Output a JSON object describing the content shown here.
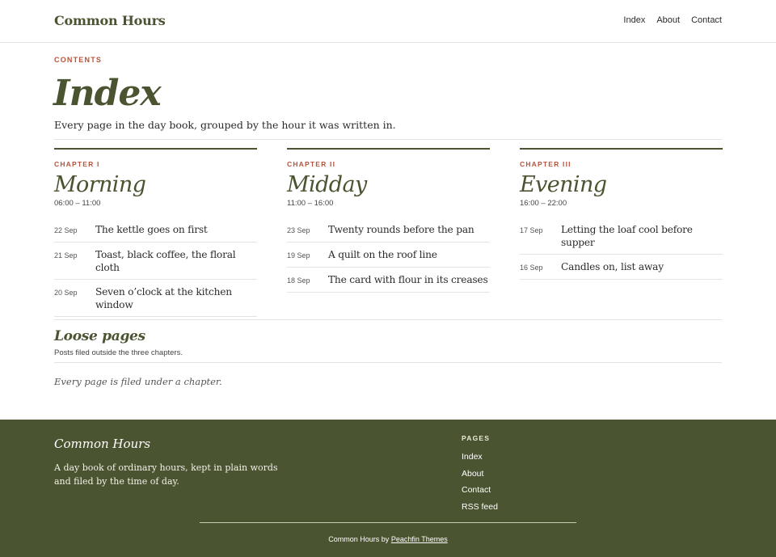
{
  "site": {
    "brand": "Common Hours"
  },
  "nav": {
    "items": [
      "Index",
      "About",
      "Contact"
    ]
  },
  "page": {
    "eyebrow": "CONTENTS",
    "title": "Index",
    "lede": "Every page in the day book, grouped by the hour it was written in."
  },
  "chapters": [
    {
      "label": "CHAPTER I",
      "title": "Morning",
      "range": "06:00 – 11:00",
      "posts": [
        {
          "date": "22 Sep",
          "title": "The kettle goes on first"
        },
        {
          "date": "21 Sep",
          "title": "Toast, black coffee, the floral cloth"
        },
        {
          "date": "20 Sep",
          "title": "Seven o’clock at the kitchen window"
        }
      ]
    },
    {
      "label": "CHAPTER II",
      "title": "Midday",
      "range": "11:00 – 16:00",
      "posts": [
        {
          "date": "23 Sep",
          "title": "Twenty rounds before the pan"
        },
        {
          "date": "19 Sep",
          "title": "A quilt on the roof line"
        },
        {
          "date": "18 Sep",
          "title": "The card with flour in its creases"
        }
      ]
    },
    {
      "label": "CHAPTER III",
      "title": "Evening",
      "range": "16:00 – 22:00",
      "posts": [
        {
          "date": "17 Sep",
          "title": "Letting the loaf cool before supper"
        },
        {
          "date": "16 Sep",
          "title": "Candles on, list away"
        }
      ]
    }
  ],
  "loose": {
    "title": "Loose pages",
    "subtitle": "Posts filed outside the three chapters.",
    "note": "Every page is filed under a chapter."
  },
  "footer": {
    "brand": "Common Hours",
    "description": "A day book of ordinary hours, kept in plain words and filed by the time of day.",
    "pages_heading": "PAGES",
    "links": [
      "Index",
      "About",
      "Contact",
      "RSS feed"
    ],
    "credit_prefix": "Common Hours by",
    "credit_link": "Peachfin Themes"
  },
  "colors": {
    "accent": "#4a5431",
    "eyebrow": "#b8523a",
    "rule": "#e3e3e3"
  }
}
